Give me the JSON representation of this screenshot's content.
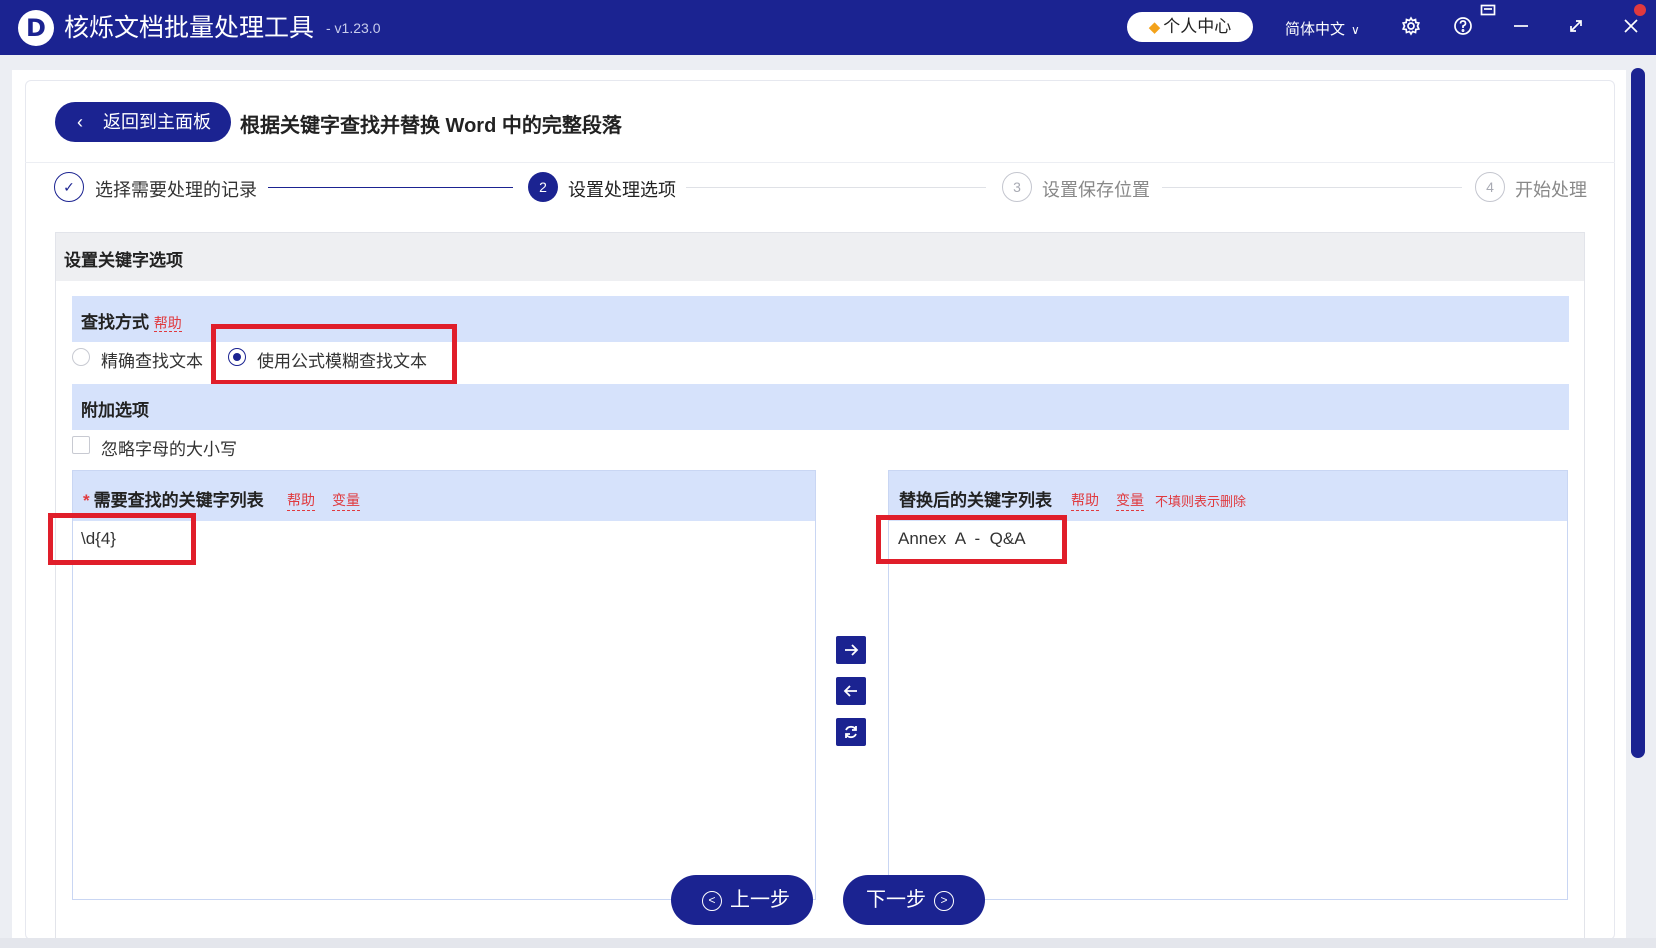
{
  "app": {
    "logo_letter": "D",
    "title": "核烁文档批量处理工具",
    "version": "- v1.23.0",
    "user_center": "个人中心",
    "language": "简体中文"
  },
  "header": {
    "back_label": "返回到主面板",
    "page_title": "根据关键字查找并替换 Word 中的完整段落"
  },
  "steps": [
    {
      "num": "✓",
      "label": "选择需要处理的记录",
      "state": "done"
    },
    {
      "num": "2",
      "label": "设置处理选项",
      "state": "active"
    },
    {
      "num": "3",
      "label": "设置保存位置",
      "state": "todo"
    },
    {
      "num": "4",
      "label": "开始处理",
      "state": "todo"
    }
  ],
  "settings": {
    "title": "设置关键字选项",
    "search_mode": {
      "label": "查找方式",
      "help": "帮助",
      "options": [
        "精确查找文本",
        "使用公式模糊查找文本"
      ],
      "selected": "使用公式模糊查找文本"
    },
    "extra": {
      "label": "附加选项",
      "ignore_case": "忽略字母的大小写",
      "ignore_case_checked": false
    },
    "find_list": {
      "required_mark": "*",
      "title": "需要查找的关键字列表",
      "help": "帮助",
      "vars": "变量",
      "value": "\\d{4}"
    },
    "replace_list": {
      "title": "替换后的关键字列表",
      "help": "帮助",
      "vars": "变量",
      "note": "不填则表示删除",
      "value": "Annex  A  -  Q&A"
    }
  },
  "nav": {
    "prev": "上一步",
    "next": "下一步"
  },
  "colors": {
    "primary": "#1b2391",
    "section_bg": "#d6e2fb",
    "accent_red": "#e0393e",
    "highlight_red": "#e01e2a"
  }
}
